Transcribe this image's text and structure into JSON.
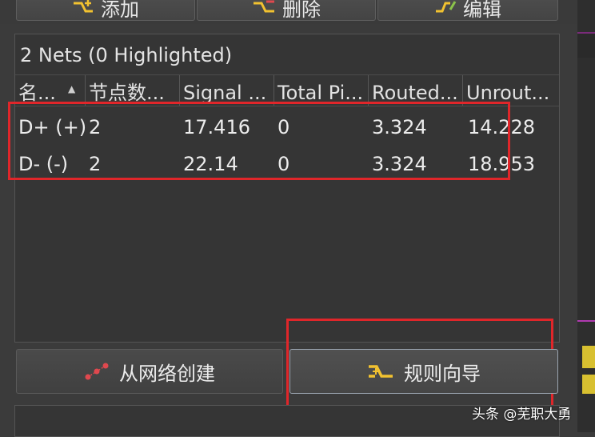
{
  "toolbar": {
    "add_label": "添加",
    "delete_label": "删除",
    "edit_label": "编辑"
  },
  "net_panel": {
    "title": "2 Nets (0 Highlighted)",
    "columns": [
      "名...",
      "节点数...",
      "Signal ...",
      "Total Pi...",
      "Routed...",
      "Unrout..."
    ],
    "rows": [
      [
        "D+ (+)",
        "2",
        "17.416",
        "0",
        "3.324",
        "14.228"
      ],
      [
        "D- (-)",
        "2",
        "22.14",
        "0",
        "3.324",
        "18.953"
      ]
    ]
  },
  "buttons": {
    "create_from_net": "从网络创建",
    "rule_wizard": "规则向导"
  },
  "watermark": "头条 @芜职大勇",
  "colors": {
    "background": "#3b3b3b",
    "highlight": "#e0262a",
    "icon_yellow": "#f2c230",
    "icon_red": "#e0484e"
  }
}
